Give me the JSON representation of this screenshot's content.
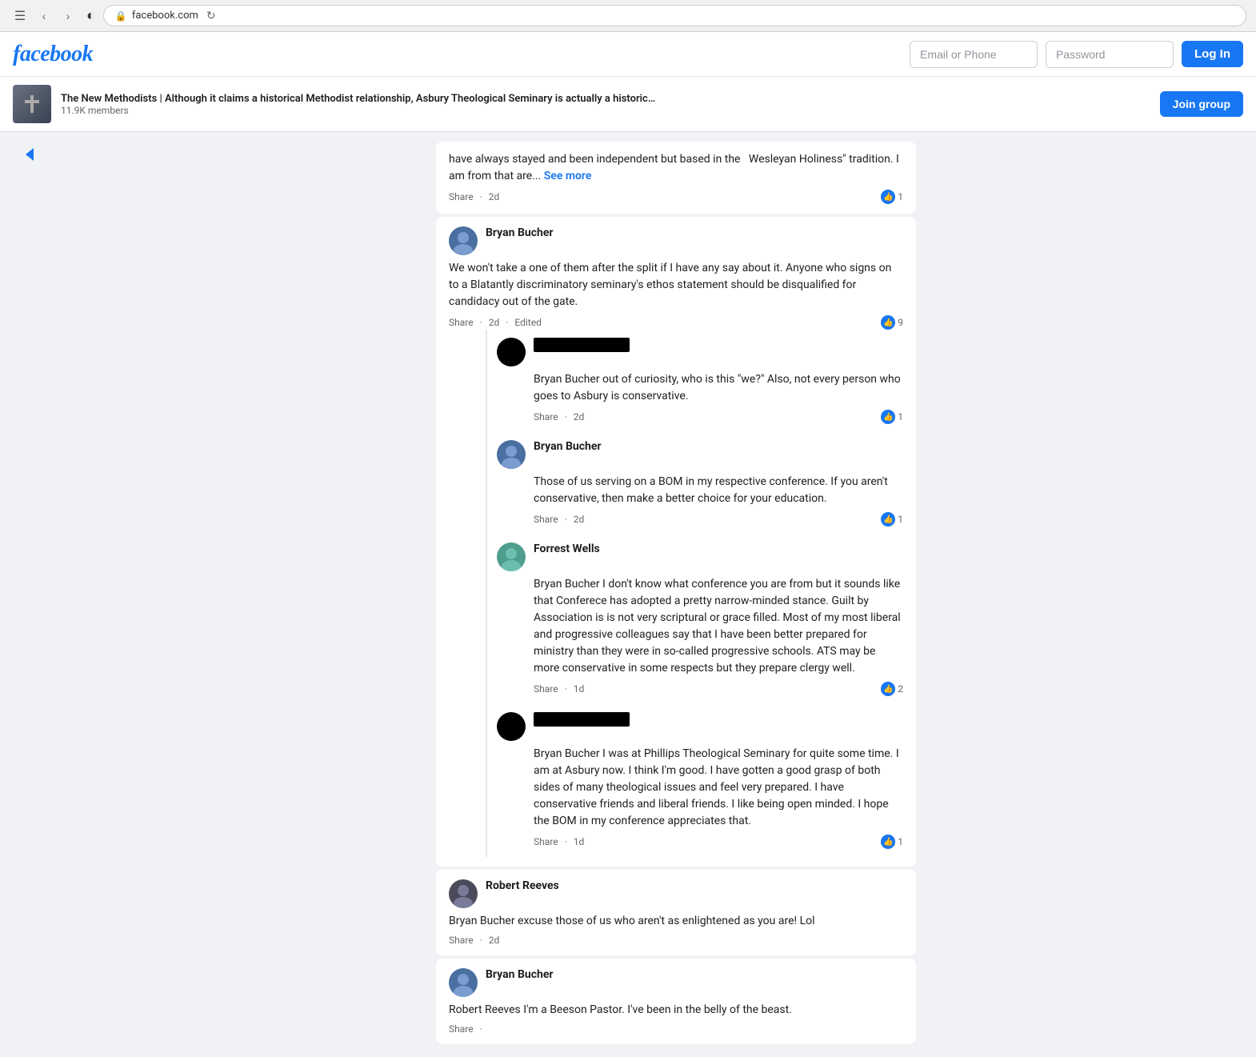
{
  "browser": {
    "url": "facebook.com",
    "url_icon": "🔒",
    "refresh_icon": "↻"
  },
  "navbar": {
    "logo": "facebook",
    "email_placeholder": "Email or Phone",
    "password_placeholder": "Password",
    "login_label": "Log In"
  },
  "group_header": {
    "name": "The New Methodists | Although it claims a historical Methodist relationship, Asbury Theological Seminary is actually a historical ...",
    "members": "11.9K members",
    "join_label": "Join group"
  },
  "comments": [
    {
      "id": "truncated_top",
      "text_partial": "have always stayed and been independent but based in the   Wesleyan Holiness\" tradition. I am from that are...",
      "see_more": "See more",
      "actions": [
        "Share",
        "·",
        "2d"
      ],
      "likes": 1
    },
    {
      "id": "bryan_bucher_1",
      "author": "Bryan Bucher",
      "text": "We won't take a one of them after the split if I have any say about it. Anyone who signs on to a Blatantly discriminatory seminary's ethos statement should be disqualified for candidacy out of the gate.",
      "actions": [
        "Share",
        "·",
        "2d",
        "·",
        "Edited"
      ],
      "likes": 9,
      "avatar_color": "avatar-blue",
      "nested": [
        {
          "id": "redacted_1",
          "author": "redacted",
          "text": "Bryan Bucher out of curiosity, who is this \"we?\" Also, not every person who goes to Asbury is conservative.",
          "actions": [
            "Share",
            "·",
            "2d"
          ],
          "likes": 1,
          "avatar_color": "avatar-gray"
        },
        {
          "id": "bryan_bucher_2",
          "author": "Bryan Bucher",
          "text": "Those of us serving on a BOM in my respective conference. If you aren't conservative, then make a better choice for your education.",
          "actions": [
            "Share",
            "·",
            "2d"
          ],
          "likes": 1,
          "avatar_color": "avatar-blue"
        },
        {
          "id": "forrest_wells",
          "author": "Forrest Wells",
          "text": "Bryan Bucher I don't know what conference you are from but it sounds like that Conferece has adopted a pretty narrow-minded stance. Guilt by Association is is not very scriptural or grace filled. Most of my most liberal and progressive colleagues say that I have been better prepared for ministry than they were in so-called progressive schools. ATS may be more conservative in some respects but they prepare clergy well.",
          "actions": [
            "Share",
            "·",
            "1d"
          ],
          "likes": 2,
          "avatar_color": "avatar-teal"
        },
        {
          "id": "redacted_2",
          "author": "redacted",
          "text": "Bryan Bucher I was at Phillips Theological Seminary for quite some time. I am at Asbury now. I think I'm good. I have gotten a good grasp of both sides of many theological issues and feel very prepared. I have conservative friends and liberal friends. I like being open minded. I hope the BOM in my conference appreciates that.",
          "actions": [
            "Share",
            "·",
            "1d"
          ],
          "likes": 1,
          "avatar_color": "avatar-gray"
        }
      ]
    },
    {
      "id": "robert_reeves",
      "author": "Robert Reeves",
      "text": "Bryan Bucher excuse those of us who aren't as enlightened as you are! Lol",
      "actions": [
        "Share",
        "·",
        "2d"
      ],
      "likes": 0,
      "avatar_color": "avatar-dark"
    },
    {
      "id": "bryan_bucher_3",
      "author": "Bryan Bucher",
      "text": "Robert Reeves I'm a Beeson Pastor. I've been in the belly of the beast.",
      "actions": [
        "Share",
        "·"
      ],
      "likes": 0,
      "avatar_color": "avatar-blue"
    }
  ]
}
